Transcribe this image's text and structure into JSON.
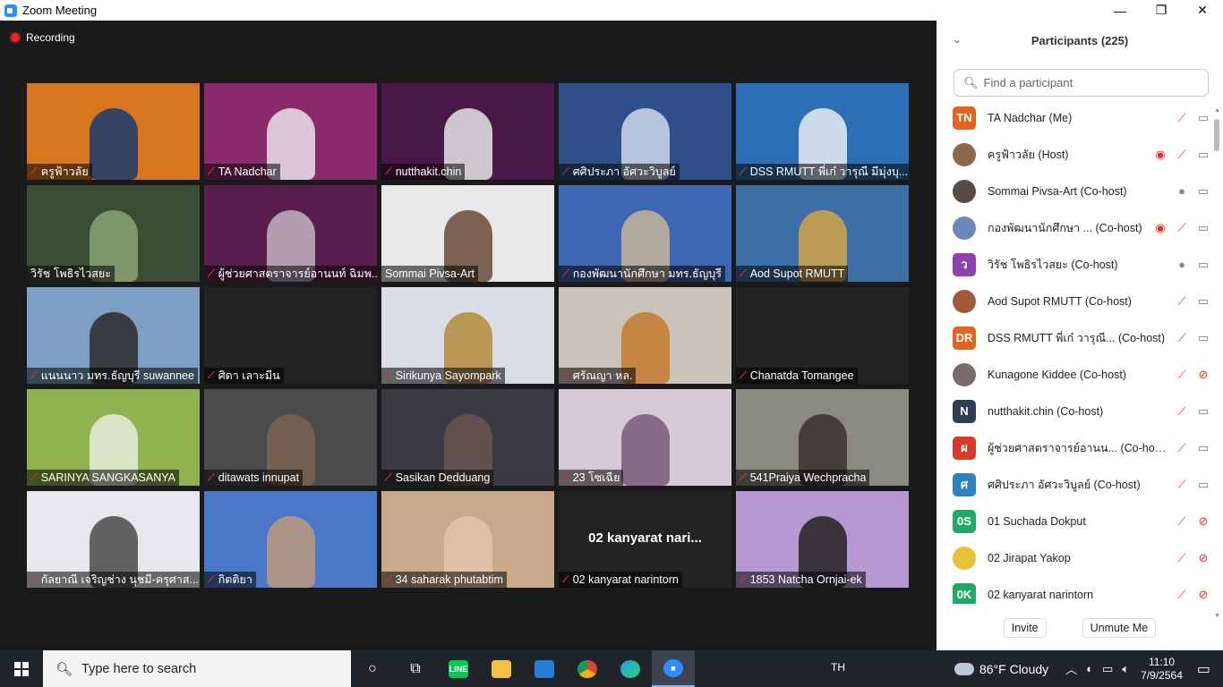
{
  "window": {
    "title": "Zoom Meeting",
    "minimize": "—",
    "maximize": "❐",
    "close": "✕"
  },
  "recording": {
    "label": "Recording"
  },
  "tiles": [
    {
      "name": "ครูฟ้าวลัย",
      "muted": true,
      "bg": "#d8751f",
      "fg": "#1a3c6e"
    },
    {
      "name": "TA Nadchar",
      "muted": true,
      "bg": "#8a2a6c",
      "fg": "#e9e2ea"
    },
    {
      "name": "nutthakit.chin",
      "muted": true,
      "bg": "#4a1848",
      "fg": "#e6e6e6"
    },
    {
      "name": "ศศิประภา อัศวะวิบูลย์",
      "muted": true,
      "bg": "#2e4f8a",
      "fg": "#cdd7ea"
    },
    {
      "name": "DSS RMUTT พี่เก๋ วารุณี มีมุ่งบุ...",
      "muted": true,
      "bg": "#2c6fb6",
      "fg": "#e9edf3"
    },
    {
      "name": "วิรัช  โพธิรไวสยะ",
      "muted": false,
      "bg": "#3a4e36",
      "fg": "#8aa474"
    },
    {
      "name": "ผู้ช่วยศาสตราจารย์อานนท์ ฉิมพ...",
      "muted": true,
      "bg": "#5a1e4e",
      "fg": "#c6b4c3"
    },
    {
      "name": "Sommai Pivsa-Art",
      "muted": false,
      "bg": "#e8e8ea",
      "fg": "#6a4a3a",
      "active": true
    },
    {
      "name": "กองพัฒนานักศึกษา มทร.ธัญบุรี",
      "muted": true,
      "bg": "#3b68b0",
      "fg": "#c9b49a"
    },
    {
      "name": "Aod Supot RMUTT",
      "muted": true,
      "bg": "#3d6fa7",
      "fg": "#d2a545"
    },
    {
      "name": "แนนนาว มทร.ธัญบุรี suwannee",
      "muted": true,
      "bg": "#7ba0c4",
      "fg": "#2a2a2a"
    },
    {
      "name": "ศิดา เลาะมีน",
      "muted": true,
      "bg": "#232323",
      "fg": "#232323"
    },
    {
      "name": "Sirikunya Sayompark",
      "muted": true,
      "bg": "#d9dde6",
      "fg": "#b48a3a"
    },
    {
      "name": "ศรัณญา หล.",
      "muted": true,
      "bg": "#c9c3b9",
      "fg": "#c47a2e"
    },
    {
      "name": "Chanatda Tomangee",
      "muted": true,
      "bg": "#232323",
      "fg": "#232323"
    },
    {
      "name": "SARINYA SANGKASANYA",
      "muted": true,
      "bg": "#8fb24e",
      "fg": "#e7ecdd"
    },
    {
      "name": "ditawats innupat",
      "muted": true,
      "bg": "#4b4b4e",
      "fg": "#7a6150"
    },
    {
      "name": "Sasikan Dedduang",
      "muted": true,
      "bg": "#3a3a42",
      "fg": "#6a5650"
    },
    {
      "name": "23 โซเฉีย",
      "muted": true,
      "bg": "#d8c9d6",
      "fg": "#7a5a7a"
    },
    {
      "name": "541Praiya Wechpracha",
      "muted": true,
      "bg": "#8a8a7e",
      "fg": "#3a3030"
    },
    {
      "name": "กัลยาณี เจริญช่าง นุชมี-ครุศาส...",
      "muted": true,
      "bg": "#e6e8ec",
      "fg": "#4a4a4a"
    },
    {
      "name": "กิตติยา",
      "muted": true,
      "bg": "#4a78c9",
      "fg": "#c09a7e"
    },
    {
      "name": "34 saharak phutabtim",
      "muted": true,
      "bg": "#c9a98a",
      "fg": "#e2c6a8"
    },
    {
      "name": "02 kanyarat narintorn",
      "muted": true,
      "bg": "#232323",
      "fg": "#232323",
      "big": "02  kanyarat nari..."
    },
    {
      "name": "1853 Natcha Ornjai-ek",
      "muted": true,
      "bg": "#b898d2",
      "fg": "#222222"
    }
  ],
  "panel": {
    "chevron": "⌄",
    "title": "Participants (225)",
    "search_placeholder": "Find a participant",
    "invite": "Invite",
    "unmute": "Unmute Me",
    "participants": [
      {
        "name": "TA Nadchar (Me)",
        "initials": "TN",
        "color": "#e3641e",
        "rec": false,
        "mic": "muted",
        "cam": "on"
      },
      {
        "name": "ครูฟ้าวลัย (Host)",
        "initials": "",
        "color": "#8a6a4a",
        "rec": true,
        "mic": "muted",
        "cam": "on"
      },
      {
        "name": "Sommai Pivsa-Art (Co-host)",
        "initials": "",
        "color": "#5a4a48",
        "rec": false,
        "mic": "on",
        "cam": "on"
      },
      {
        "name": "กองพัฒนานักศึกษา ...  (Co-host)",
        "initials": "",
        "color": "#6a88b8",
        "rec": true,
        "mic": "muted",
        "cam": "on"
      },
      {
        "name": "วิรัช  โพธิรไวสยะ (Co-host)",
        "initials": "ว",
        "color": "#8e3fb0",
        "rec": false,
        "mic": "on",
        "cam": "on"
      },
      {
        "name": "Aod Supot RMUTT (Co-host)",
        "initials": "",
        "color": "#a05a3a",
        "rec": false,
        "mic": "muted",
        "cam": "on"
      },
      {
        "name": "DSS RMUTT พี่เก๋ วารุณี... (Co-host)",
        "initials": "DR",
        "color": "#e3641e",
        "rec": false,
        "mic": "muted",
        "cam": "on"
      },
      {
        "name": "Kunagone Kiddee (Co-host)",
        "initials": "",
        "color": "#7a6a6a",
        "rec": false,
        "mic": "muted",
        "cam": "off"
      },
      {
        "name": "nutthakit.chin (Co-host)",
        "initials": "N",
        "color": "#2d3e55",
        "rec": false,
        "mic": "muted",
        "cam": "on"
      },
      {
        "name": "ผู้ช่วยศาสตราจารย์อานน...  (Co-host)",
        "initials": "ผ",
        "color": "#d63a2a",
        "rec": false,
        "mic": "muted",
        "cam": "on"
      },
      {
        "name": "ศศิประภา อัศวะวิบูลย์ (Co-host)",
        "initials": "ศ",
        "color": "#2f7fc1",
        "rec": false,
        "mic": "muted",
        "cam": "on"
      },
      {
        "name": "01 Suchada Dokput",
        "initials": "0S",
        "color": "#1faa68",
        "rec": false,
        "mic": "muted",
        "cam": "off"
      },
      {
        "name": "02 Jirapat Yakop",
        "initials": "",
        "color": "#e8c03a",
        "rec": false,
        "mic": "muted",
        "cam": "off"
      },
      {
        "name": "02 kanyarat narintorn",
        "initials": "0K",
        "color": "#1faa68",
        "rec": false,
        "mic": "muted",
        "cam": "off"
      }
    ]
  },
  "taskbar": {
    "search_placeholder": "Type here to search",
    "lang": "TH",
    "weather": "86°F  Cloudy",
    "time": "11:10",
    "date": "7/9/2564",
    "line_label": "LINE"
  }
}
